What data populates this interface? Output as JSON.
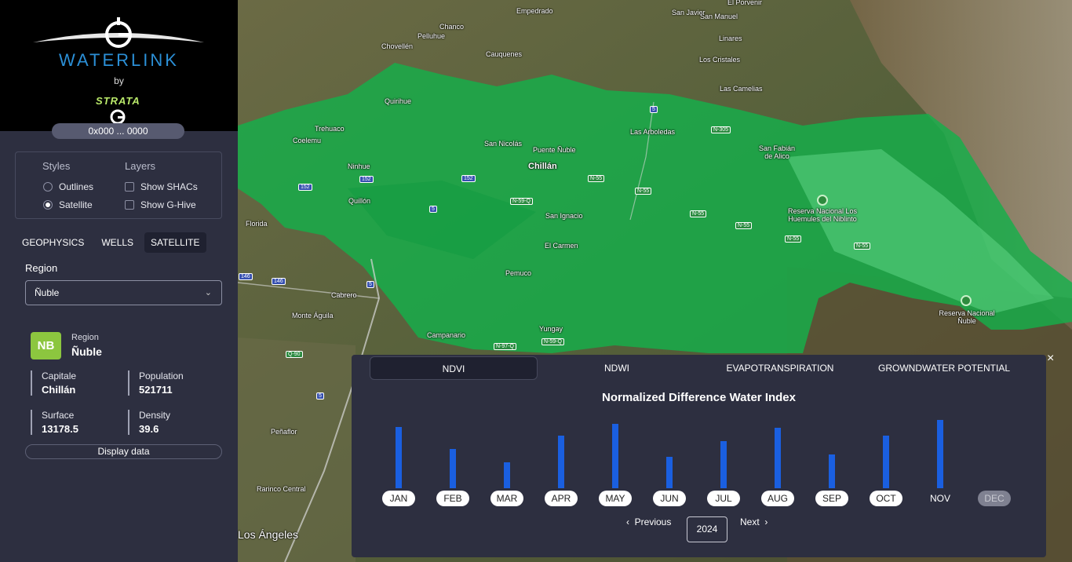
{
  "brand": {
    "title": "WATERLINK",
    "by": "by",
    "partner": "STRATA"
  },
  "wallet": "0x000 ... 0000",
  "styles": {
    "heading": "Styles",
    "options": [
      "Outlines",
      "Satellite"
    ],
    "selected": "Satellite"
  },
  "layers": {
    "heading": "Layers",
    "options": [
      "Show SHACs",
      "Show G-Hive"
    ]
  },
  "tabs": [
    "GEOPHYSICS",
    "WELLS",
    "SATELLITE"
  ],
  "active_tab": "SATELLITE",
  "region_field": {
    "label": "Region",
    "value": "Ñuble"
  },
  "region_card": {
    "badge": "NB",
    "label": "Region",
    "name": "Ñuble",
    "stats": [
      {
        "key": "Capitale",
        "value": "Chillán"
      },
      {
        "key": "Population",
        "value": "521711"
      },
      {
        "key": "Surface",
        "value": "13178.5"
      },
      {
        "key": "Density",
        "value": "39.6"
      }
    ],
    "display_button": "Display data"
  },
  "map_labels": [
    "Empedrado",
    "San Javier",
    "El Porvenir",
    "San Manuel",
    "Chanco",
    "Pelluhue",
    "Chovellén",
    "Cauquenes",
    "Linares",
    "Los Cristales",
    "Las Camelias",
    "Quirihue",
    "Trehuaco",
    "Coelemu",
    "San Nicolás",
    "Puente Ñuble",
    "Las Arboledas",
    "San Fabián de Alico",
    "Chillán",
    "Ninhue",
    "Quillón",
    "San Ignacio",
    "Florida",
    "El Carmen",
    "Pemuco",
    "Cabrero",
    "Monte Águila",
    "Campanario",
    "Yungay",
    "Peñaflor",
    "Rarinco Central",
    "Los Ángeles",
    "Reserva Nacional Los Huemules del Niblinto",
    "Reserva Nacional Ñuble"
  ],
  "road_shields": [
    "5",
    "N-305",
    "152",
    "N-55",
    "N-59-Q",
    "146",
    "Q-90",
    "N-97-Q"
  ],
  "panel": {
    "tabs": [
      "NDVI",
      "NDWI",
      "EVAPOTRANSPIRATION",
      "GROWNDWATER POTENTIAL"
    ],
    "active_tab": "NDVI",
    "close": "×",
    "previous": "Previous",
    "next": "Next",
    "year": "2024"
  },
  "chart_data": {
    "type": "bar",
    "title": "Normalized Difference Water Index",
    "categories": [
      "JAN",
      "FEB",
      "MAR",
      "APR",
      "MAY",
      "JUN",
      "JUL",
      "AUG",
      "SEP",
      "OCT",
      "NOV",
      "DEC"
    ],
    "values": [
      0.87,
      0.56,
      0.37,
      0.74,
      0.91,
      0.45,
      0.67,
      0.86,
      0.48,
      0.75,
      0.97,
      null
    ],
    "ylim": [
      0,
      1
    ],
    "selected": [
      "JAN",
      "FEB",
      "MAR",
      "APR",
      "MAY",
      "JUN",
      "JUL",
      "AUG",
      "SEP",
      "OCT"
    ],
    "disabled": [
      "DEC"
    ],
    "bar_color": "#1a5fe0"
  }
}
